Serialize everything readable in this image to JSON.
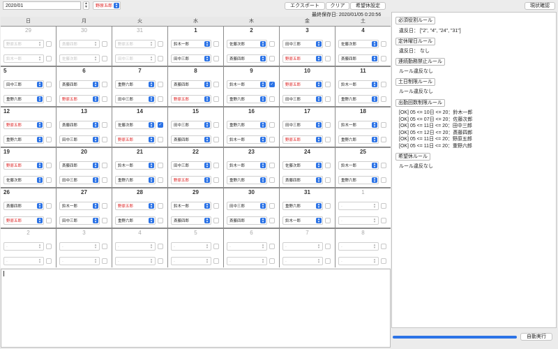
{
  "toolbar": {
    "month_value": "2020/01",
    "staff_selected": "野原五郎",
    "export_label": "エクスポート",
    "clear_label": "クリア",
    "holiday_label": "希望休設定",
    "check_label": "現状確認",
    "last_saved": "最終保存日: 2020/01/05 0:20:56"
  },
  "weekdays": [
    "日",
    "月",
    "火",
    "水",
    "木",
    "金",
    "土"
  ],
  "calendar": [
    [
      {
        "day": "29",
        "other": true,
        "slots": [
          {
            "name": "野原五郎"
          },
          {
            "name": "鈴木一郎"
          }
        ],
        "checked": false
      },
      {
        "day": "30",
        "other": true,
        "slots": [
          {
            "name": "斎藤四郎"
          },
          {
            "name": "佐藤次郎"
          }
        ],
        "checked": false
      },
      {
        "day": "31",
        "other": true,
        "slots": [
          {
            "name": "野原五郎"
          },
          {
            "name": "田中三郎"
          }
        ],
        "checked": false
      },
      {
        "day": "1",
        "slots": [
          {
            "name": "鈴木一郎",
            "arrow": true
          },
          {
            "name": "田中三郎",
            "arrow": true
          }
        ],
        "checked": false
      },
      {
        "day": "2",
        "slots": [
          {
            "name": "佐藤次郎",
            "arrow": true
          },
          {
            "name": "斎藤四郎",
            "arrow": true
          }
        ],
        "checked": false
      },
      {
        "day": "3",
        "slots": [
          {
            "name": "田中三郎",
            "arrow": true
          },
          {
            "name": "野原五郎",
            "red": true,
            "arrow": true
          }
        ],
        "checked": false
      },
      {
        "day": "4",
        "slots": [
          {
            "name": "佐藤次郎",
            "arrow": true
          },
          {
            "name": "斎藤四郎",
            "arrow": true
          }
        ],
        "checked": false
      }
    ],
    [
      {
        "day": "5",
        "left": true,
        "slots": [
          {
            "name": "田中三郎",
            "arrow": true
          },
          {
            "name": "重野六郎",
            "arrow": true
          }
        ],
        "checked": false
      },
      {
        "day": "6",
        "slots": [
          {
            "name": "斎藤四郎",
            "arrow": true
          },
          {
            "name": "野原五郎",
            "red": true,
            "arrow": true
          }
        ],
        "checked": false
      },
      {
        "day": "7",
        "slots": [
          {
            "name": "重野六郎",
            "arrow": true
          },
          {
            "name": "田中三郎",
            "arrow": true
          }
        ],
        "checked": false
      },
      {
        "day": "8",
        "slots": [
          {
            "name": "斎藤四郎",
            "arrow": true
          },
          {
            "name": "野原五郎",
            "red": true,
            "arrow": true
          }
        ],
        "checked": false
      },
      {
        "day": "9",
        "slots": [
          {
            "name": "鈴木一郎",
            "arrow": true
          },
          {
            "name": "重野六郎",
            "arrow": true
          }
        ],
        "checked": true
      },
      {
        "day": "10",
        "slots": [
          {
            "name": "野原五郎",
            "red": true,
            "arrow": true
          },
          {
            "name": "田中三郎",
            "arrow": true
          }
        ],
        "checked": false
      },
      {
        "day": "11",
        "slots": [
          {
            "name": "鈴木一郎",
            "arrow": true
          },
          {
            "name": "重野六郎",
            "arrow": true
          }
        ],
        "checked": false
      }
    ],
    [
      {
        "day": "12",
        "left": true,
        "slots": [
          {
            "name": "野原五郎",
            "red": true,
            "arrow": true
          },
          {
            "name": "重野六郎",
            "arrow": true
          }
        ],
        "checked": false
      },
      {
        "day": "13",
        "slots": [
          {
            "name": "斎藤四郎",
            "arrow": true
          },
          {
            "name": "田中三郎",
            "arrow": true
          }
        ],
        "checked": false
      },
      {
        "day": "14",
        "slots": [
          {
            "name": "佐藤次郎",
            "arrow": true
          },
          {
            "name": "野原五郎",
            "red": true,
            "arrow": true
          }
        ],
        "checked": true
      },
      {
        "day": "15",
        "slots": [
          {
            "name": "田中三郎",
            "arrow": true
          },
          {
            "name": "斎藤四郎",
            "arrow": true
          }
        ],
        "checked": false
      },
      {
        "day": "16",
        "slots": [
          {
            "name": "重野六郎",
            "arrow": true
          },
          {
            "name": "鈴木一郎",
            "arrow": true
          }
        ],
        "checked": false
      },
      {
        "day": "17",
        "slots": [
          {
            "name": "田中三郎",
            "arrow": true
          },
          {
            "name": "野原五郎",
            "red": true,
            "arrow": true
          }
        ],
        "checked": false
      },
      {
        "day": "18",
        "slots": [
          {
            "name": "鈴木一郎",
            "arrow": true
          },
          {
            "name": "重野六郎",
            "arrow": true
          }
        ],
        "checked": false
      }
    ],
    [
      {
        "day": "19",
        "left": true,
        "slots": [
          {
            "name": "野原五郎",
            "red": true,
            "arrow": true
          },
          {
            "name": "佐藤次郎",
            "arrow": true
          }
        ],
        "checked": false
      },
      {
        "day": "20",
        "slots": [
          {
            "name": "斎藤四郎",
            "arrow": true
          },
          {
            "name": "田中三郎",
            "arrow": true
          }
        ],
        "checked": false
      },
      {
        "day": "21",
        "slots": [
          {
            "name": "鈴木一郎",
            "arrow": true
          },
          {
            "name": "重野六郎",
            "arrow": true
          }
        ],
        "checked": false
      },
      {
        "day": "22",
        "slots": [
          {
            "name": "田中三郎",
            "arrow": true
          },
          {
            "name": "野原五郎",
            "red": true,
            "arrow": true
          }
        ],
        "checked": false
      },
      {
        "day": "23",
        "slots": [
          {
            "name": "鈴木一郎",
            "arrow": true
          },
          {
            "name": "重野六郎",
            "arrow": true
          }
        ],
        "checked": false
      },
      {
        "day": "24",
        "slots": [
          {
            "name": "佐藤次郎",
            "arrow": true
          },
          {
            "name": "斎藤四郎",
            "arrow": true
          }
        ],
        "checked": false
      },
      {
        "day": "25",
        "slots": [
          {
            "name": "鈴木一郎",
            "arrow": true
          },
          {
            "name": "重野六郎",
            "arrow": true
          }
        ],
        "checked": false
      }
    ],
    [
      {
        "day": "26",
        "left": true,
        "slots": [
          {
            "name": "斎藤四郎",
            "arrow": true
          },
          {
            "name": "野原五郎",
            "red": true,
            "arrow": true
          }
        ],
        "checked": false
      },
      {
        "day": "27",
        "slots": [
          {
            "name": "鈴木一郎",
            "arrow": true
          },
          {
            "name": "田中三郎",
            "arrow": true
          }
        ],
        "checked": false
      },
      {
        "day": "28",
        "slots": [
          {
            "name": "野原五郎",
            "red": true,
            "arrow": true
          },
          {
            "name": "重野六郎",
            "arrow": true
          }
        ],
        "checked": false
      },
      {
        "day": "29",
        "slots": [
          {
            "name": "鈴木一郎",
            "arrow": true
          },
          {
            "name": "斎藤四郎",
            "arrow": true
          }
        ],
        "checked": false
      },
      {
        "day": "30",
        "slots": [
          {
            "name": "田中三郎",
            "arrow": true
          },
          {
            "name": "斎藤四郎",
            "arrow": true
          }
        ],
        "checked": false
      },
      {
        "day": "31",
        "slots": [
          {
            "name": "重野六郎",
            "arrow": true
          },
          {
            "name": "鈴木一郎",
            "arrow": true
          }
        ],
        "checked": false
      },
      {
        "day": "1",
        "other": true,
        "slots": [
          {
            "name": "-"
          },
          {
            "name": "-"
          }
        ],
        "checked": false
      }
    ],
    [
      {
        "day": "2",
        "other": true,
        "slots": [
          {
            "name": "-"
          },
          {
            "name": "-"
          }
        ],
        "checked": false
      },
      {
        "day": "3",
        "other": true,
        "slots": [
          {
            "name": "-"
          },
          {
            "name": "-"
          }
        ],
        "checked": false
      },
      {
        "day": "4",
        "other": true,
        "slots": [
          {
            "name": "-"
          },
          {
            "name": "-"
          }
        ],
        "checked": false
      },
      {
        "day": "5",
        "other": true,
        "slots": [
          {
            "name": "-"
          },
          {
            "name": "-"
          }
        ],
        "checked": false
      },
      {
        "day": "6",
        "other": true,
        "slots": [
          {
            "name": "-"
          },
          {
            "name": "-"
          }
        ],
        "checked": false
      },
      {
        "day": "7",
        "other": true,
        "slots": [
          {
            "name": "-"
          },
          {
            "name": "-"
          }
        ],
        "checked": false
      },
      {
        "day": "8",
        "other": true,
        "slots": [
          {
            "name": "-"
          },
          {
            "name": "-"
          }
        ],
        "checked": false
      }
    ]
  ],
  "rules": {
    "required_role": {
      "title": "必須役割ルール",
      "text": "違反日：  [\"2\", \"4\", \"24\", \"31\"]"
    },
    "fixed_holiday": {
      "title": "定休曜日ルール",
      "text": "違反日：  なし"
    },
    "consecutive": {
      "title": "連続勤務禁止ルール",
      "text": "ルール違反なし"
    },
    "weekend_limit": {
      "title": "土日制限ルール",
      "text": "ルール違反なし"
    },
    "attendance_limit": {
      "title": "出勤回数制限ルール",
      "lines": [
        "[OK] 05 <= 10日 <= 20：鈴木一郎",
        "[OK] 05 <= 07日 <= 20：佐藤次郎",
        "[OK] 05 <= 11日 <= 20：田中三郎",
        "[OK] 05 <= 12日 <= 20：斎藤四郎",
        "[OK] 05 <= 11日 <= 20：野原五郎",
        "[OK] 05 <= 11日 <= 20：重野六郎"
      ]
    },
    "holiday_request": {
      "title": "希望休ルール",
      "text": "ルール違反なし"
    }
  },
  "footer": {
    "auto_run_label": "自動実行",
    "progress": 1.0
  }
}
